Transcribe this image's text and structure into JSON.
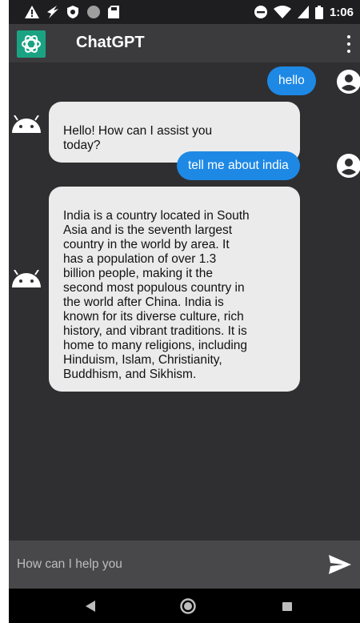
{
  "status_bar": {
    "time": "1:06",
    "left_icons": [
      "warning-icon",
      "feather-icon",
      "shield-icon",
      "circle-icon",
      "sd-card-icon"
    ],
    "right_icons": [
      "do-not-disturb-icon",
      "wifi-icon",
      "signal-icon",
      "battery-icon"
    ]
  },
  "app_bar": {
    "title": "ChatGPT",
    "logo_icon": "openai-logo-icon",
    "menu_icon": "more-vert-icon"
  },
  "messages": [
    {
      "sender": "user",
      "text": "hello"
    },
    {
      "sender": "bot",
      "text": "Hello! How can I assist you\ntoday?"
    },
    {
      "sender": "user",
      "text": "tell me about india"
    },
    {
      "sender": "bot",
      "text": "India is a country located in South\nAsia and is the seventh largest\ncountry in the world by area. It\nhas a population of over 1.3\nbillion people, making it the\nsecond most populous country in\nthe world after China. India is\nknown for its diverse culture, rich\nhistory, and vibrant traditions. It is\nhome to many religions, including\nHinduism, Islam, Christianity,\nBuddhism, and Sikhism."
    }
  ],
  "input": {
    "placeholder": "How can I help you",
    "value": "",
    "send_icon": "send-icon"
  },
  "nav_bar": {
    "back_icon": "back-triangle-icon",
    "home_icon": "home-circle-icon",
    "recents_icon": "recents-square-icon"
  },
  "colors": {
    "background": "#2f2f31",
    "app_bar": "#3b3b3d",
    "status_bar": "#1e1e20",
    "user_bubble": "#1e88e5",
    "bot_bubble": "#ebebeb",
    "logo": "#1aa383",
    "input_bar": "#48484b"
  }
}
